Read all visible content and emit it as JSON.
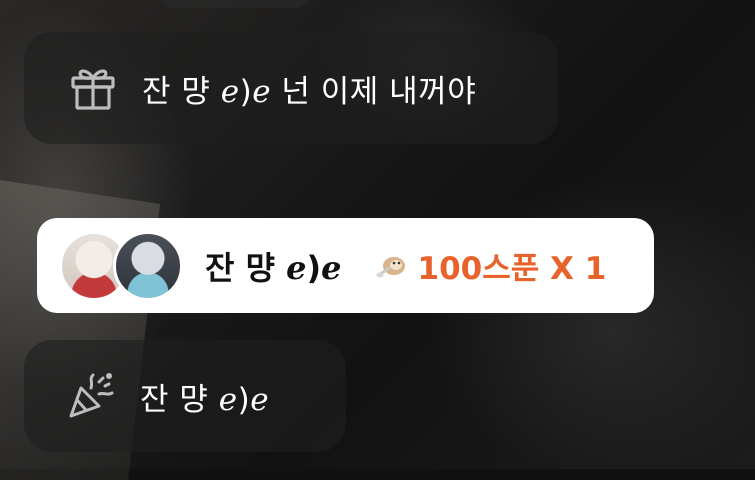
{
  "gift_message": {
    "icon": "gift-icon",
    "text": "잔 먕 ℯ)ℯ 넌 이제 내꺼야"
  },
  "gift_notification": {
    "avatars": [
      "user-avatar",
      "recipient-avatar"
    ],
    "sender_name": "잔 먕 ℯ)ℯ",
    "gift_icon": "otter-spoon-icon",
    "gift_amount": "100스푼 X 1",
    "accent_color": "#e8632b"
  },
  "join_message": {
    "icon": "party-popper-icon",
    "text": "잔 먕 ℯ)ℯ"
  }
}
